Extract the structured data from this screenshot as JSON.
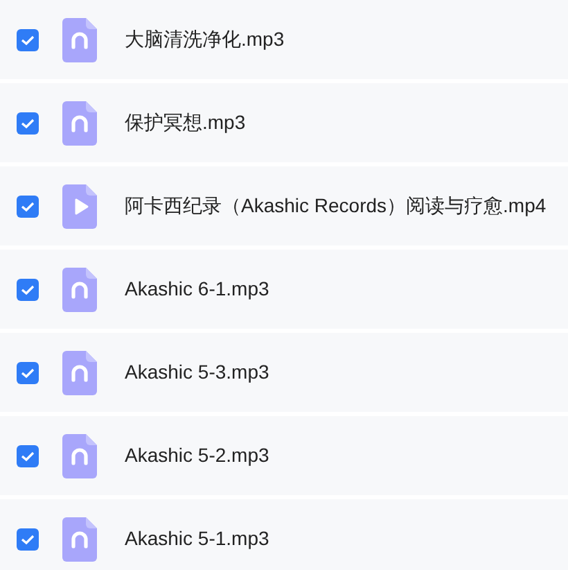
{
  "files": [
    {
      "name": "大脑清洗净化.mp3",
      "kind": "audio",
      "checked": true
    },
    {
      "name": "保护冥想.mp3",
      "kind": "audio",
      "checked": true
    },
    {
      "name": "阿卡西纪录（Akashic Records）阅读与疗愈.mp4",
      "kind": "video",
      "checked": true
    },
    {
      "name": "Akashic 6-1.mp3",
      "kind": "audio",
      "checked": true
    },
    {
      "name": "Akashic 5-3.mp3",
      "kind": "audio",
      "checked": true
    },
    {
      "name": "Akashic 5-2.mp3",
      "kind": "audio",
      "checked": true
    },
    {
      "name": "Akashic 5-1.mp3",
      "kind": "audio",
      "checked": true
    }
  ]
}
